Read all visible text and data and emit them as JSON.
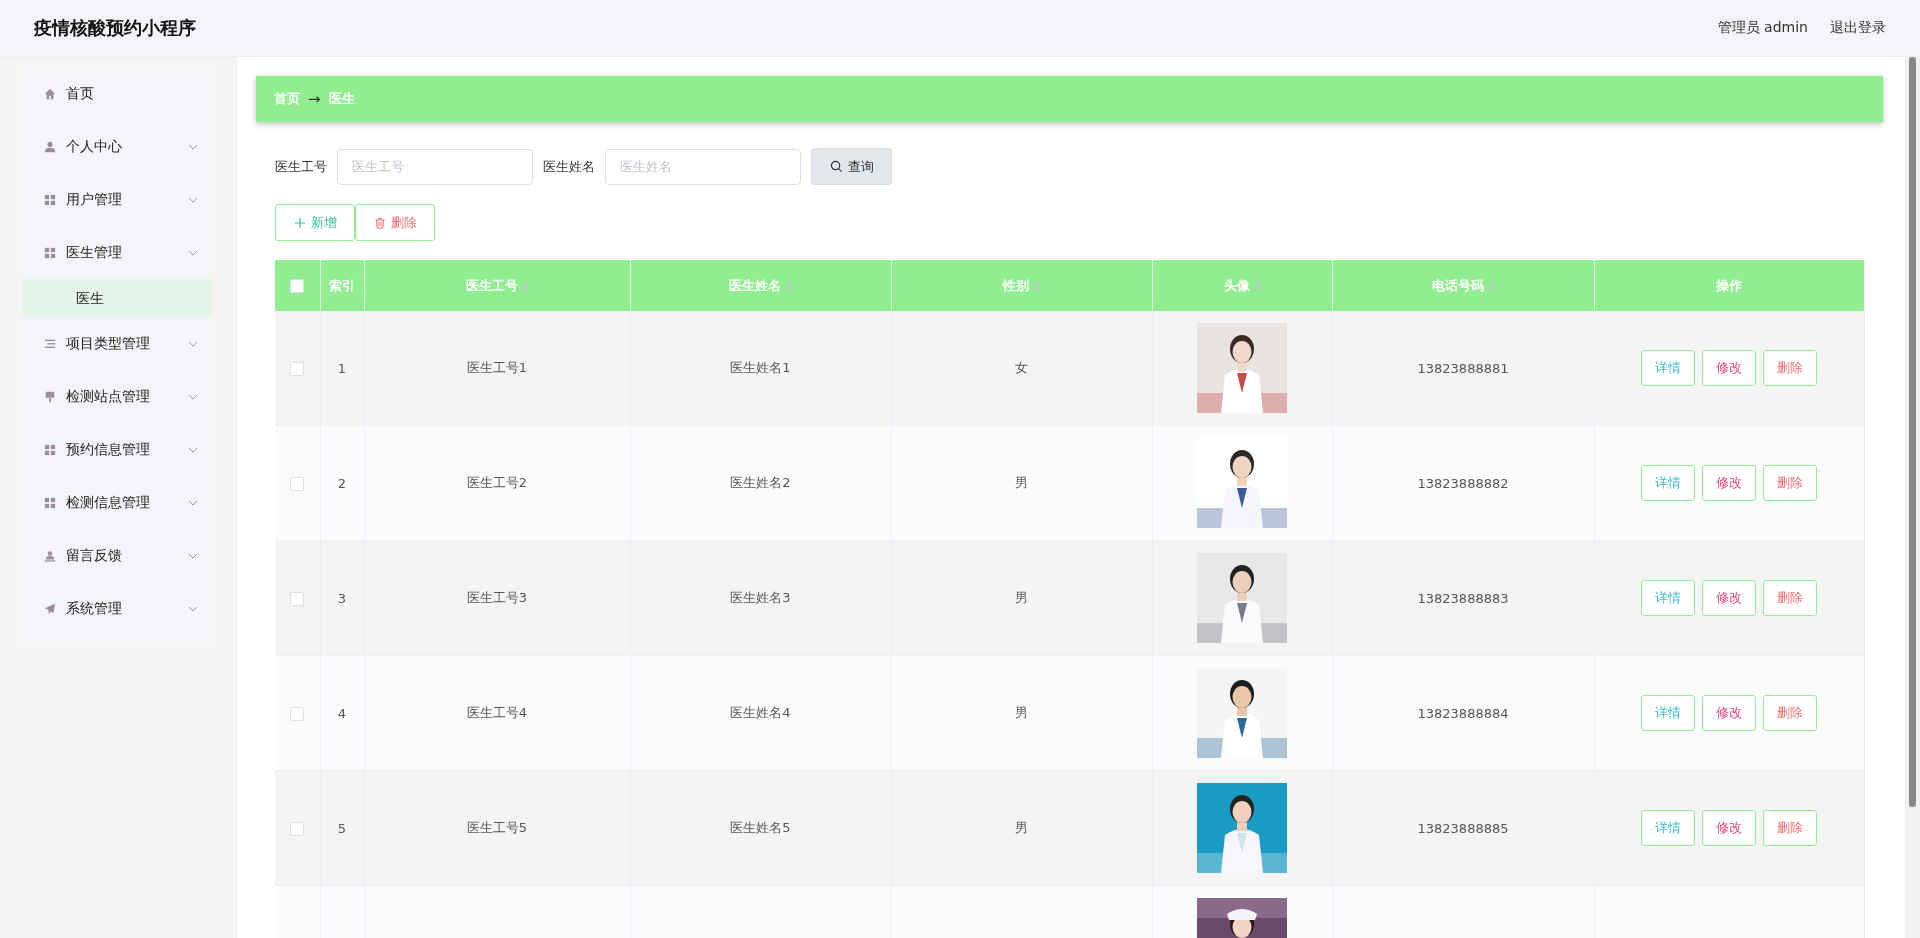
{
  "header": {
    "title": "疫情核酸预约小程序",
    "user": "管理员 admin",
    "logout": "退出登录"
  },
  "sidebar": {
    "items": [
      {
        "label": "首页",
        "kind": "home",
        "expandable": false
      },
      {
        "label": "个人中心",
        "kind": "person",
        "expandable": true
      },
      {
        "label": "用户管理",
        "kind": "grid",
        "expandable": true
      },
      {
        "label": "医生管理",
        "kind": "grid",
        "expandable": true,
        "children": [
          {
            "label": "医生",
            "selected": true
          }
        ]
      },
      {
        "label": "项目类型管理",
        "kind": "list",
        "expandable": true
      },
      {
        "label": "检测站点管理",
        "kind": "pin",
        "expandable": true
      },
      {
        "label": "预约信息管理",
        "kind": "grid",
        "expandable": true
      },
      {
        "label": "检测信息管理",
        "kind": "grid",
        "expandable": true
      },
      {
        "label": "留言反馈",
        "kind": "user",
        "expandable": true
      },
      {
        "label": "系统管理",
        "kind": "send",
        "expandable": true
      }
    ]
  },
  "breadcrumb": [
    "首页",
    "医生"
  ],
  "breadcrumb_separator": "→",
  "search": {
    "fields": [
      {
        "label": "医生工号",
        "placeholder": "医生工号"
      },
      {
        "label": "医生姓名",
        "placeholder": "医生姓名"
      }
    ],
    "button": "查询"
  },
  "actions": [
    {
      "label": "新增",
      "kind": "add"
    },
    {
      "label": "删除",
      "kind": "delete"
    }
  ],
  "table": {
    "columns": [
      {
        "label": "索引",
        "sortable": false
      },
      {
        "label": "医生工号",
        "sortable": true
      },
      {
        "label": "医生姓名",
        "sortable": true
      },
      {
        "label": "性别",
        "sortable": true
      },
      {
        "label": "头像",
        "sortable": true
      },
      {
        "label": "电话号码",
        "sortable": true
      },
      {
        "label": "操作",
        "sortable": false
      }
    ],
    "select_all": false,
    "rows": [
      {
        "index": "1",
        "id": "医生工号1",
        "name": "医生姓名1",
        "gender": "女",
        "phone": "13823888881",
        "checked": false,
        "buttons": [
          {
            "label": "详情",
            "kind": "detail"
          },
          {
            "label": "修改",
            "kind": "edit"
          },
          {
            "label": "删除",
            "kind": "delete"
          }
        ]
      },
      {
        "index": "2",
        "id": "医生工号2",
        "name": "医生姓名2",
        "gender": "男",
        "phone": "13823888882",
        "checked": false,
        "buttons": [
          {
            "label": "详情",
            "kind": "detail"
          },
          {
            "label": "修改",
            "kind": "edit"
          },
          {
            "label": "删除",
            "kind": "delete"
          }
        ]
      },
      {
        "index": "3",
        "id": "医生工号3",
        "name": "医生姓名3",
        "gender": "男",
        "phone": "13823888883",
        "checked": false,
        "buttons": [
          {
            "label": "详情",
            "kind": "detail"
          },
          {
            "label": "修改",
            "kind": "edit"
          },
          {
            "label": "删除",
            "kind": "delete"
          }
        ]
      },
      {
        "index": "4",
        "id": "医生工号4",
        "name": "医生姓名4",
        "gender": "男",
        "phone": "13823888884",
        "checked": false,
        "buttons": [
          {
            "label": "详情",
            "kind": "detail"
          },
          {
            "label": "修改",
            "kind": "edit"
          },
          {
            "label": "删除",
            "kind": "delete"
          }
        ]
      },
      {
        "index": "5",
        "id": "医生工号5",
        "name": "医生姓名5",
        "gender": "男",
        "phone": "13823888885",
        "checked": false,
        "buttons": [
          {
            "label": "详情",
            "kind": "detail"
          },
          {
            "label": "修改",
            "kind": "edit"
          },
          {
            "label": "删除",
            "kind": "delete"
          }
        ]
      }
    ]
  }
}
